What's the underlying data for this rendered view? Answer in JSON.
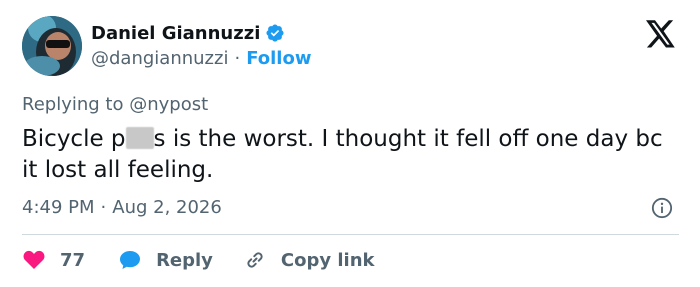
{
  "author": {
    "name": "Daniel Giannuzzi",
    "handle": "@dangiannuzzi",
    "separator": "·",
    "follow_label": "Follow",
    "verified_color": "#1d9bf0"
  },
  "reply_context": {
    "prefix": "Replying to",
    "mention": "@nypost"
  },
  "tweet": {
    "text_part1": "Bicycle p",
    "text_part2": "s is the worst. I thought it fell off one day bc it lost all feeling.",
    "time": "4:49 PM",
    "separator": "·",
    "date": "Aug 2, 2026"
  },
  "actions": {
    "like_count": "77",
    "reply_label": "Reply",
    "copy_label": "Copy link"
  },
  "icons": {
    "brand": "x-logo-icon",
    "info": "info-icon",
    "like": "heart-icon",
    "reply": "speech-bubble-icon",
    "copy": "link-icon"
  },
  "colors": {
    "accent": "#1d9bf0",
    "like": "#f91880",
    "text": "#0f1419",
    "muted": "#536471"
  }
}
